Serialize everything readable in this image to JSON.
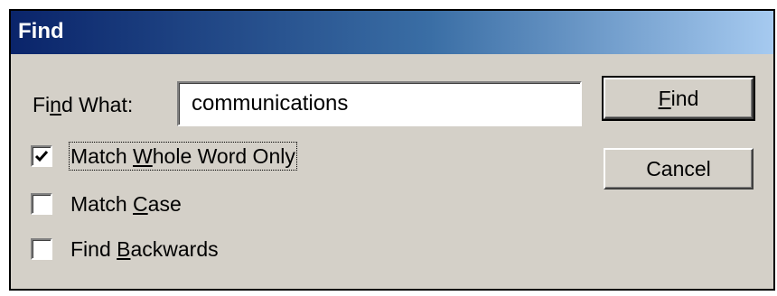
{
  "window": {
    "title": "Find"
  },
  "find_what": {
    "label_pre": "Fi",
    "label_accel": "n",
    "label_post": "d What:",
    "value": "communications"
  },
  "options": [
    {
      "label_pre": "Match ",
      "label_accel": "W",
      "label_post": "hole Word Only",
      "checked": true
    },
    {
      "label_pre": "Match ",
      "label_accel": "C",
      "label_post": "ase",
      "checked": false
    },
    {
      "label_pre": "Find ",
      "label_accel": "B",
      "label_post": "ackwards",
      "checked": false
    }
  ],
  "buttons": {
    "find": {
      "label_accel": "F",
      "label_post": "ind"
    },
    "cancel": {
      "label": "Cancel"
    }
  },
  "colors": {
    "dialog_bg": "#d4d0c8",
    "title_start": "#0a246a",
    "title_end": "#a6caf0"
  }
}
